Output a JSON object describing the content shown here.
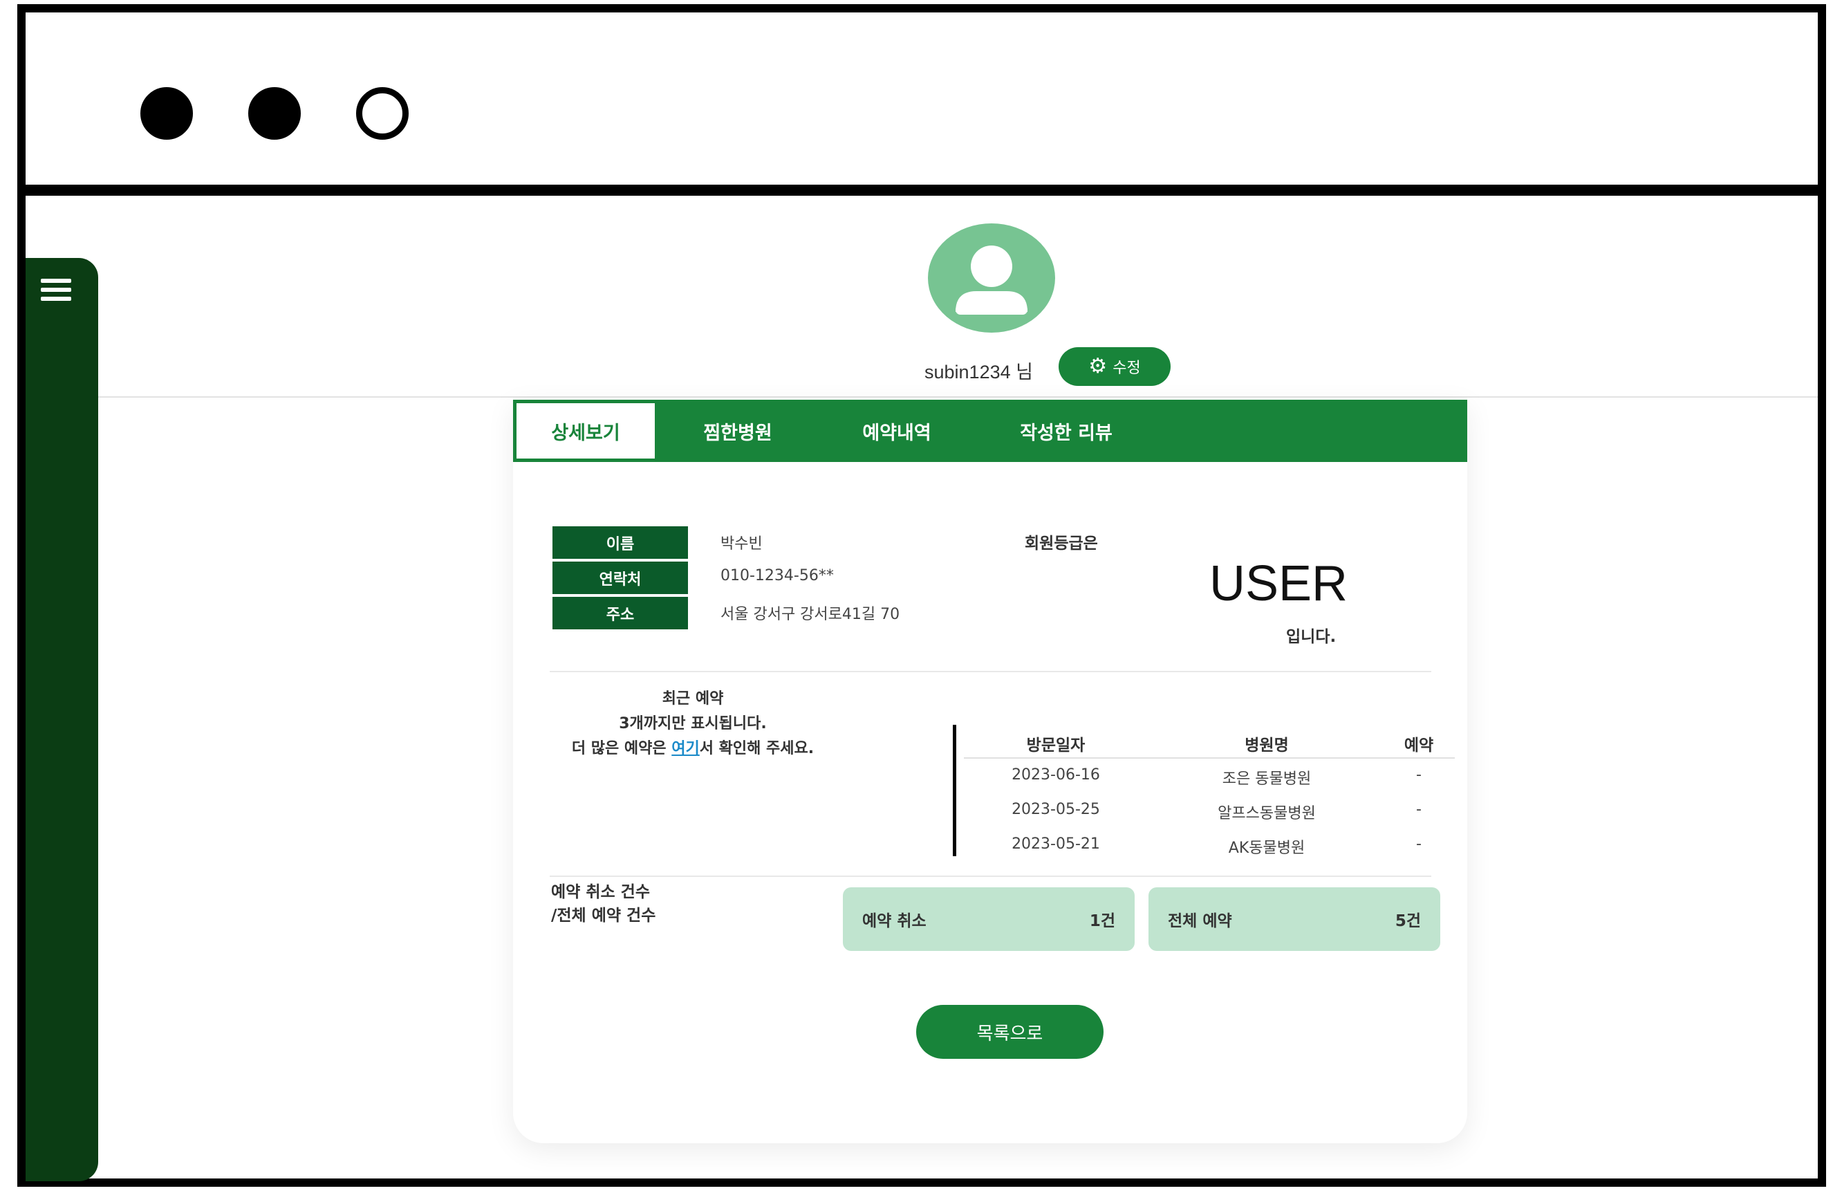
{
  "window": {
    "controls": [
      "filled",
      "filled",
      "outline"
    ]
  },
  "sidebar": {
    "menu_icon": "hamburger-menu-icon"
  },
  "profile": {
    "avatar_icon": "user-avatar-icon",
    "username": "subin1234 님",
    "edit_icon": "gear-icon",
    "edit_label": "수정"
  },
  "tabs": [
    {
      "label": "상세보기",
      "active": true
    },
    {
      "label": "찜한병원",
      "active": false
    },
    {
      "label": "예약내역",
      "active": false
    },
    {
      "label": "작성한 리뷰",
      "active": false
    }
  ],
  "info": {
    "name_label": "이름",
    "name_value": "박수빈",
    "phone_label": "연락처",
    "phone_value": "010-1234-56**",
    "address_label": "주소",
    "address_value": "서울 강서구 강서로41길 70"
  },
  "grade": {
    "title": "회원등급은",
    "value": "USER",
    "suffix": "입니다."
  },
  "recent": {
    "line1": "최근 예약",
    "line2": "3개까지만 표시됩니다.",
    "line3_prefix": "더 많은 예약은 ",
    "link_text": "여기",
    "line3_suffix": "서 확인해 주세요.",
    "headers": [
      "방문일자",
      "병원명",
      "예약"
    ],
    "rows": [
      {
        "date": "2023-06-16",
        "hospital": "조은 동물병원",
        "status": "-"
      },
      {
        "date": "2023-05-25",
        "hospital": "알프스동물병원",
        "status": "-"
      },
      {
        "date": "2023-05-21",
        "hospital": "AK동물병원",
        "status": "-"
      }
    ]
  },
  "stats": {
    "label_line1": "예약 취소 건수",
    "label_line2": "/전체 예약 건수",
    "cancel_label": "예약 취소",
    "cancel_count": "1건",
    "total_label": "전체 예약",
    "total_count": "5건"
  },
  "back_button": "목록으로",
  "colors": {
    "primary": "#18843a",
    "sidebar": "#0b3d14",
    "avatar": "#77c492",
    "stat_card": "#c0e4cf",
    "link": "#1b8ac9"
  }
}
